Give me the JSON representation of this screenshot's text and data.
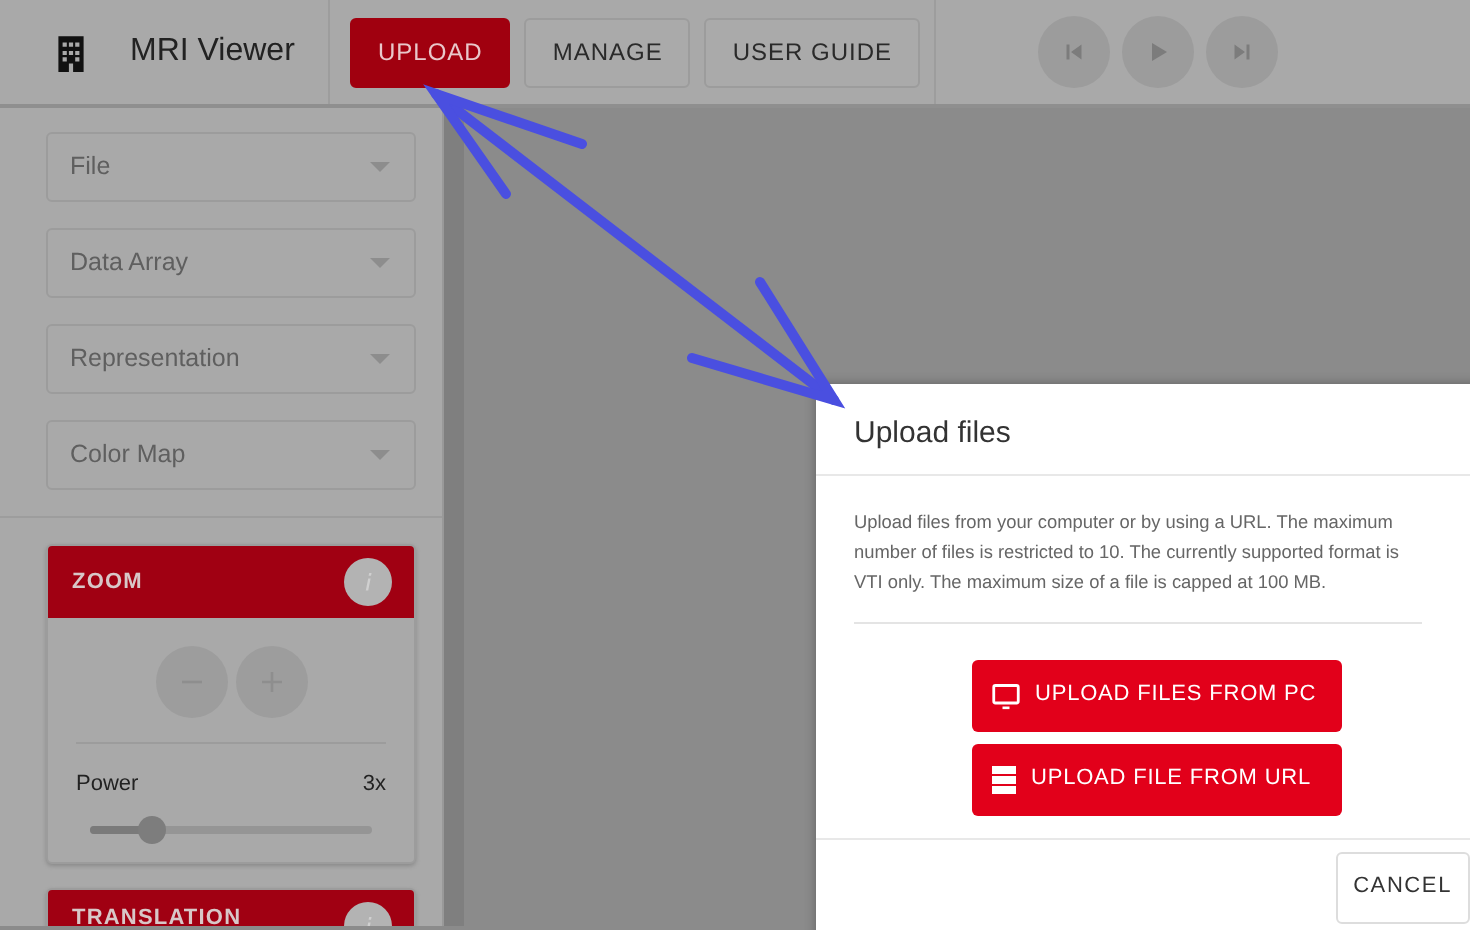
{
  "app": {
    "title": "MRI Viewer"
  },
  "nav_buttons": [
    {
      "label": "UPLOAD",
      "selected": true
    },
    {
      "label": "MANAGE",
      "selected": false
    },
    {
      "label": "USER GUIDE",
      "selected": false
    }
  ],
  "playback_buttons": [
    {
      "kind": "previous"
    },
    {
      "kind": "play"
    },
    {
      "kind": "next"
    }
  ],
  "sidebar": {
    "selects": [
      {
        "placeholder": "File"
      },
      {
        "placeholder": "Data Array"
      },
      {
        "placeholder": "Representation"
      },
      {
        "placeholder": "Color Map"
      }
    ],
    "panels": [
      {
        "kind": "zoom",
        "title": "ZOOM",
        "power_label": "Power",
        "power_value": "3x",
        "level": 0.22
      },
      {
        "kind": "header_only",
        "title": "TRANSLATION"
      }
    ]
  },
  "dialog": {
    "title": "Upload files",
    "text": "Upload files from your computer or by using a URL. The maximum number of files is restricted to 10. The currently supported format is VTI only. The maximum size of a file is capped at 100 MB.",
    "buttons": [
      {
        "kind": "pc",
        "label": "UPLOAD FILES FROM PC"
      },
      {
        "kind": "url",
        "label": "UPLOAD FILE FROM URL"
      }
    ],
    "cancel": "CANCEL"
  }
}
